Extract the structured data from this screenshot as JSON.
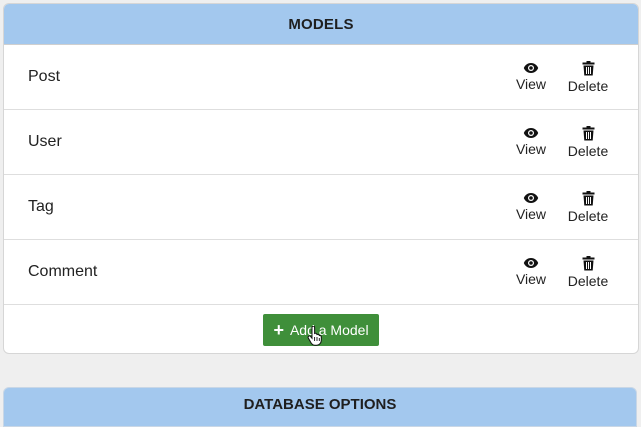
{
  "models_panel": {
    "title": "MODELS",
    "rows": [
      {
        "name": "Post",
        "view_label": "View",
        "delete_label": "Delete"
      },
      {
        "name": "User",
        "view_label": "View",
        "delete_label": "Delete"
      },
      {
        "name": "Tag",
        "view_label": "View",
        "delete_label": "Delete"
      },
      {
        "name": "Comment",
        "view_label": "View",
        "delete_label": "Delete"
      }
    ],
    "add_button_label": "Add a Model",
    "add_button_color": "#3f8f3a",
    "header_color": "#a3c8ee"
  },
  "database_panel": {
    "title": "DATABASE OPTIONS"
  },
  "icons": {
    "view": "eye-icon",
    "delete": "trash-icon",
    "add": "plus-icon",
    "cursor": "hand-pointer-cursor-icon"
  }
}
